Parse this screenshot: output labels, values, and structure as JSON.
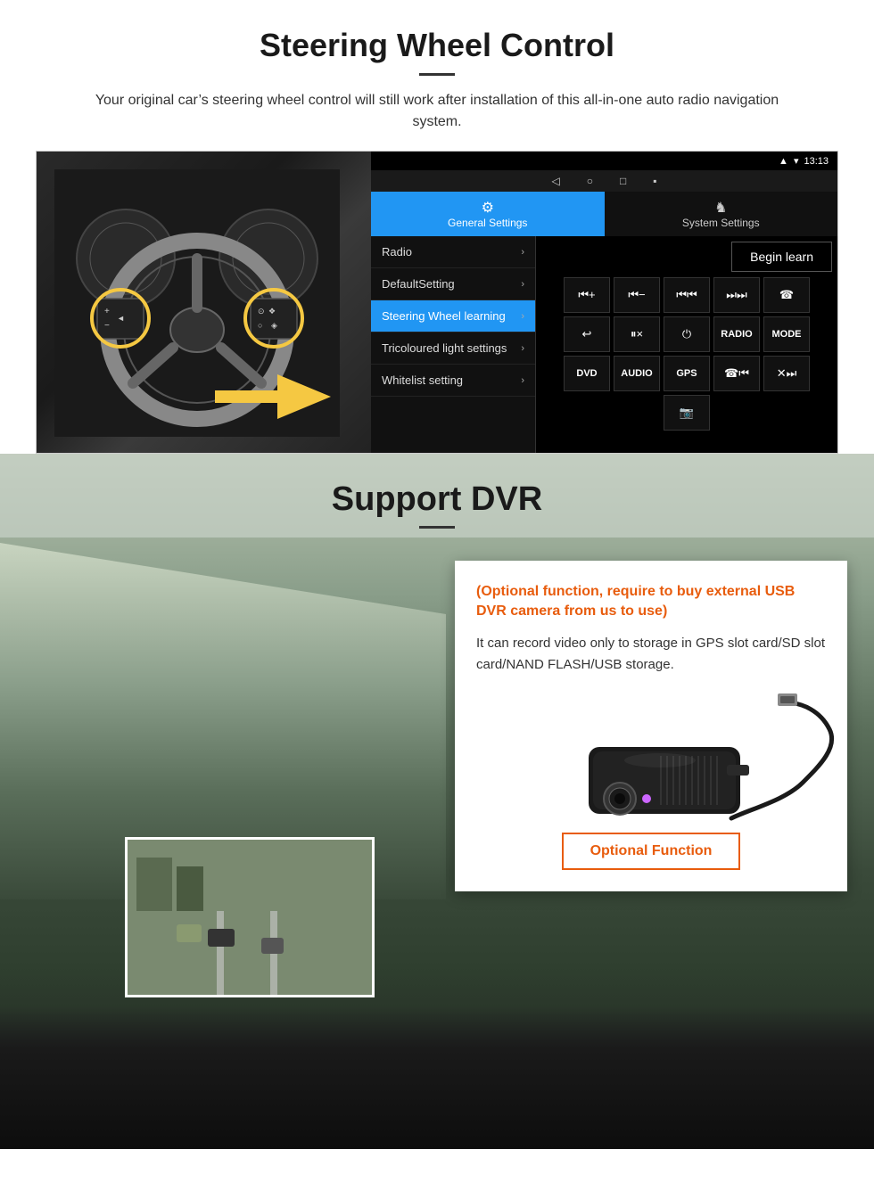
{
  "steering_section": {
    "title": "Steering Wheel Control",
    "subtitle": "Your original car’s steering wheel control will still work after installation of this all-in-one auto radio navigation system.",
    "status_bar": {
      "signal_icon": "□",
      "wifi": "▼",
      "time": "13:13"
    },
    "nav_buttons": [
      "◁",
      "○",
      "□",
      "▣"
    ],
    "tabs": [
      {
        "label": "General Settings",
        "icon": "⚙",
        "active": true
      },
      {
        "label": "System Settings",
        "icon": "♞",
        "active": false
      }
    ],
    "menu_items": [
      {
        "label": "Radio",
        "active": false
      },
      {
        "label": "DefaultSetting",
        "active": false
      },
      {
        "label": "Steering Wheel learning",
        "active": true
      },
      {
        "label": "Tricoloured light settings",
        "active": false
      },
      {
        "label": "Whitelist setting",
        "active": false
      }
    ],
    "begin_learn": "Begin learn",
    "control_buttons_row1": [
      "⏮+",
      "⏮−",
      "⏮⏮",
      "⏭⏭",
      "☎"
    ],
    "control_buttons_row2": [
      "⤵",
      "⏸×",
      "⏻",
      "RADIO",
      "MODE"
    ],
    "control_buttons_row3": [
      "DVD",
      "AUDIO",
      "GPS",
      "☎⏮",
      "✕⏭"
    ],
    "control_buttons_row4": [
      "📹"
    ]
  },
  "dvr_section": {
    "title": "Support DVR",
    "optional_text": "(Optional function, require to buy external USB DVR camera from us to use)",
    "desc_text": "It can record video only to storage in GPS slot card/SD slot card/NAND FLASH/USB storage.",
    "optional_function_btn": "Optional Function"
  }
}
